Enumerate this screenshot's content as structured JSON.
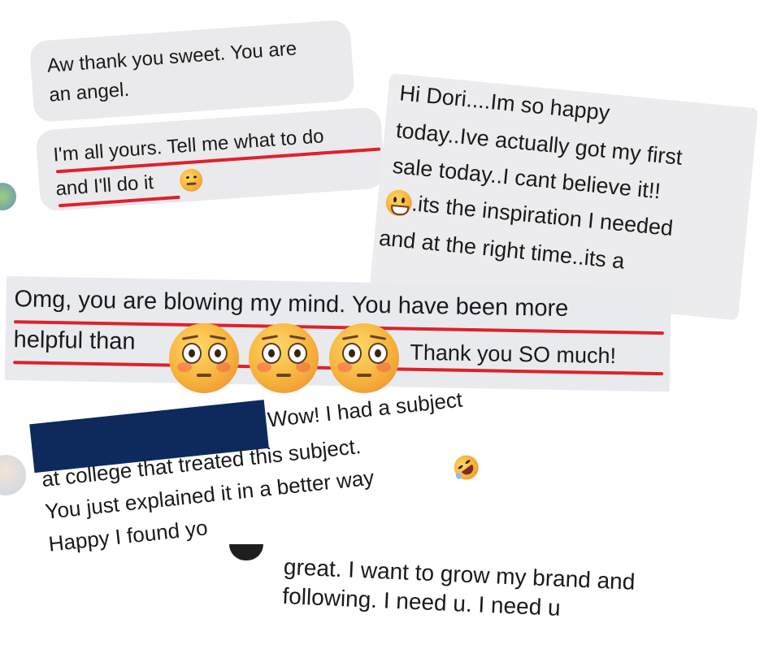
{
  "msg_a": {
    "line1": "Aw thank you sweet. You are",
    "line2": "an angel.",
    "line3": "I'm all yours. Tell me what to do",
    "line4": "and I'll do it"
  },
  "msg_b": {
    "line1": "Hi Dori....Im so happy",
    "line2": "today..Ive actually got my first",
    "line3": "sale today..I cant believe it!!",
    "line4": ".its the inspiration I needed",
    "line5": "and at the right time..its a"
  },
  "msg_c": {
    "line1": "Omg, you are blowing my mind. You have been more",
    "line2a": "helpful than",
    "line2b": "Thank you SO much!"
  },
  "msg_d": {
    "line1": "Wow! I had a subject",
    "line2": "at college that treated this subject.",
    "line3": "You just explained it in a better way",
    "line4": "Happy I found yo"
  },
  "msg_e": {
    "line1": "great. I want to grow my brand and",
    "line2": "following.  I need u.  I need u"
  },
  "icons": [
    "hugging-face-emoji",
    "grinning-face-emoji",
    "flushed-face-emoji",
    "rofl-emoji"
  ],
  "colors": {
    "underline": "#e0202a",
    "redaction": "#0e2a5c",
    "bubble": "#eaeaec"
  }
}
